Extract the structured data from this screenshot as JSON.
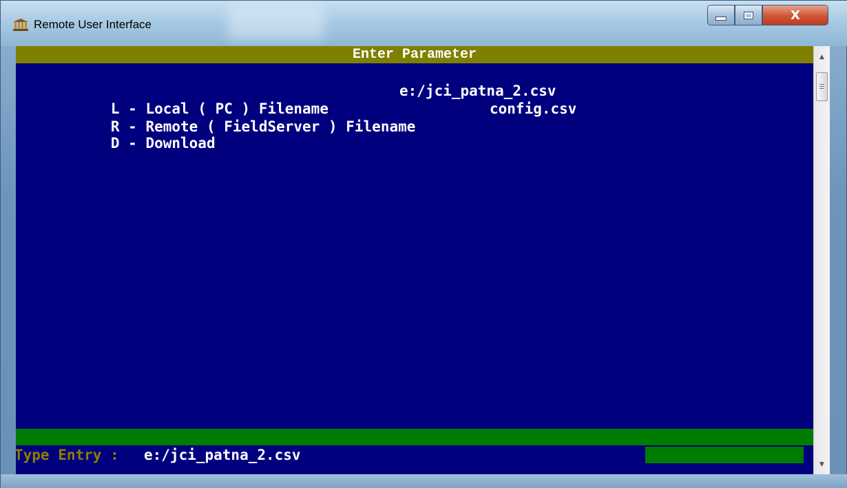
{
  "window": {
    "title": "Remote User Interface",
    "close_label": "X"
  },
  "console": {
    "header": "Enter Parameter",
    "menu": [
      {
        "key": "L",
        "label": "Local ( PC ) Filename",
        "value": "e:/jci_patna_2.csv"
      },
      {
        "key": "R",
        "label": "Remote ( FieldServer ) Filename",
        "value": "config.csv"
      },
      {
        "key": "D",
        "label": "Download",
        "value": ""
      }
    ],
    "entry_label": "Type Entry : ",
    "entry_value": "e:/jci_patna_2.csv"
  },
  "colors": {
    "console_bg": "#00007f",
    "header_bg": "#808000",
    "status_bar_bg": "#007c00",
    "text": "#ffffff"
  },
  "icons": {
    "app": "building-columns-icon",
    "minimize": "minimize-icon",
    "maximize": "maximize-icon",
    "close": "close-icon"
  }
}
